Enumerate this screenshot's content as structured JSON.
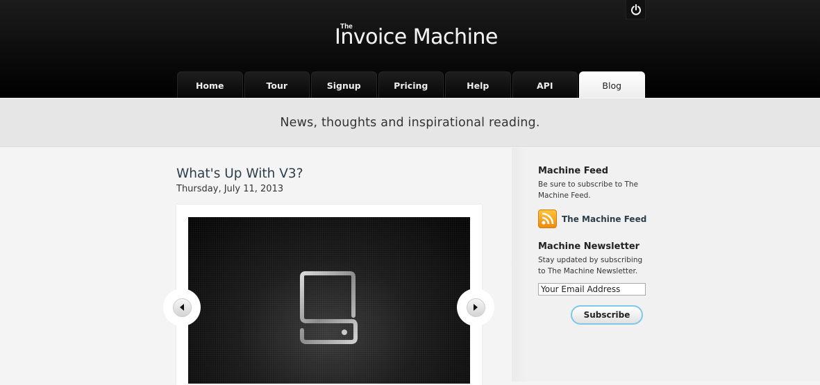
{
  "header": {
    "logo_small": "The",
    "logo_main": "Invoice Machine",
    "power_icon": "power-icon"
  },
  "nav": {
    "tabs": [
      {
        "label": "Home",
        "active": false
      },
      {
        "label": "Tour",
        "active": false
      },
      {
        "label": "Signup",
        "active": false
      },
      {
        "label": "Pricing",
        "active": false
      },
      {
        "label": "Help",
        "active": false
      },
      {
        "label": "API",
        "active": false
      },
      {
        "label": "Blog",
        "active": true
      }
    ]
  },
  "tagline": "News, thoughts and inspirational reading.",
  "post": {
    "title": "What's Up With V3?",
    "date": "Thursday, July 11, 2013",
    "slider": {
      "prev_icon": "arrow-left-icon",
      "next_icon": "arrow-right-icon",
      "slide_icon": "device-icon"
    }
  },
  "sidebar": {
    "feed": {
      "heading": "Machine Feed",
      "description": "Be sure to subscribe to The Machine Feed.",
      "link_label": "The Machine Feed",
      "icon": "rss-icon"
    },
    "newsletter": {
      "heading": "Machine Newsletter",
      "description": "Stay updated by subscribing to The Machine Newsletter.",
      "email_value": "Your Email Address",
      "button_label": "Subscribe"
    }
  },
  "colors": {
    "header_bg": "#000000",
    "tagline_bg": "#e6e6e6",
    "page_bg": "#f4f4f4",
    "title_color": "#2c3e4a",
    "rss_orange": "#f4a023",
    "subscribe_border": "#7fc7e8"
  }
}
